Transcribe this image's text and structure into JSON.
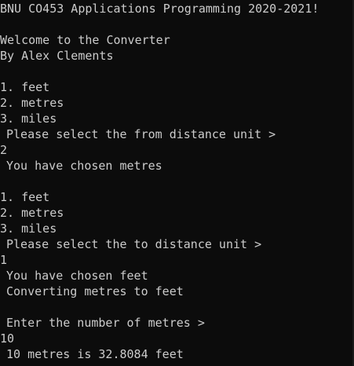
{
  "console": {
    "lines": [
      {
        "text": "BNU CO453 Applications Programming 2020-2021!",
        "indent": false
      },
      {
        "text": "",
        "indent": false
      },
      {
        "text": "Welcome to the Converter",
        "indent": false
      },
      {
        "text": "By Alex Clements",
        "indent": false
      },
      {
        "text": "",
        "indent": false
      },
      {
        "text": "1. feet",
        "indent": false
      },
      {
        "text": "2. metres",
        "indent": false
      },
      {
        "text": "3. miles",
        "indent": false
      },
      {
        "text": "Please select the from distance unit >",
        "indent": true
      },
      {
        "text": "2",
        "indent": false
      },
      {
        "text": "You have chosen metres",
        "indent": true
      },
      {
        "text": "",
        "indent": false
      },
      {
        "text": "1. feet",
        "indent": false
      },
      {
        "text": "2. metres",
        "indent": false
      },
      {
        "text": "3. miles",
        "indent": false
      },
      {
        "text": "Please select the to distance unit >",
        "indent": true
      },
      {
        "text": "1",
        "indent": false
      },
      {
        "text": "You have chosen feet",
        "indent": true
      },
      {
        "text": "Converting metres to feet",
        "indent": true
      },
      {
        "text": "",
        "indent": false
      },
      {
        "text": "Enter the number of metres >",
        "indent": true
      },
      {
        "text": "10",
        "indent": false
      },
      {
        "text": "10 metres is 32.8084 feet",
        "indent": true
      }
    ]
  },
  "colors": {
    "background": "#0c0c0c",
    "text": "#cccccc"
  }
}
